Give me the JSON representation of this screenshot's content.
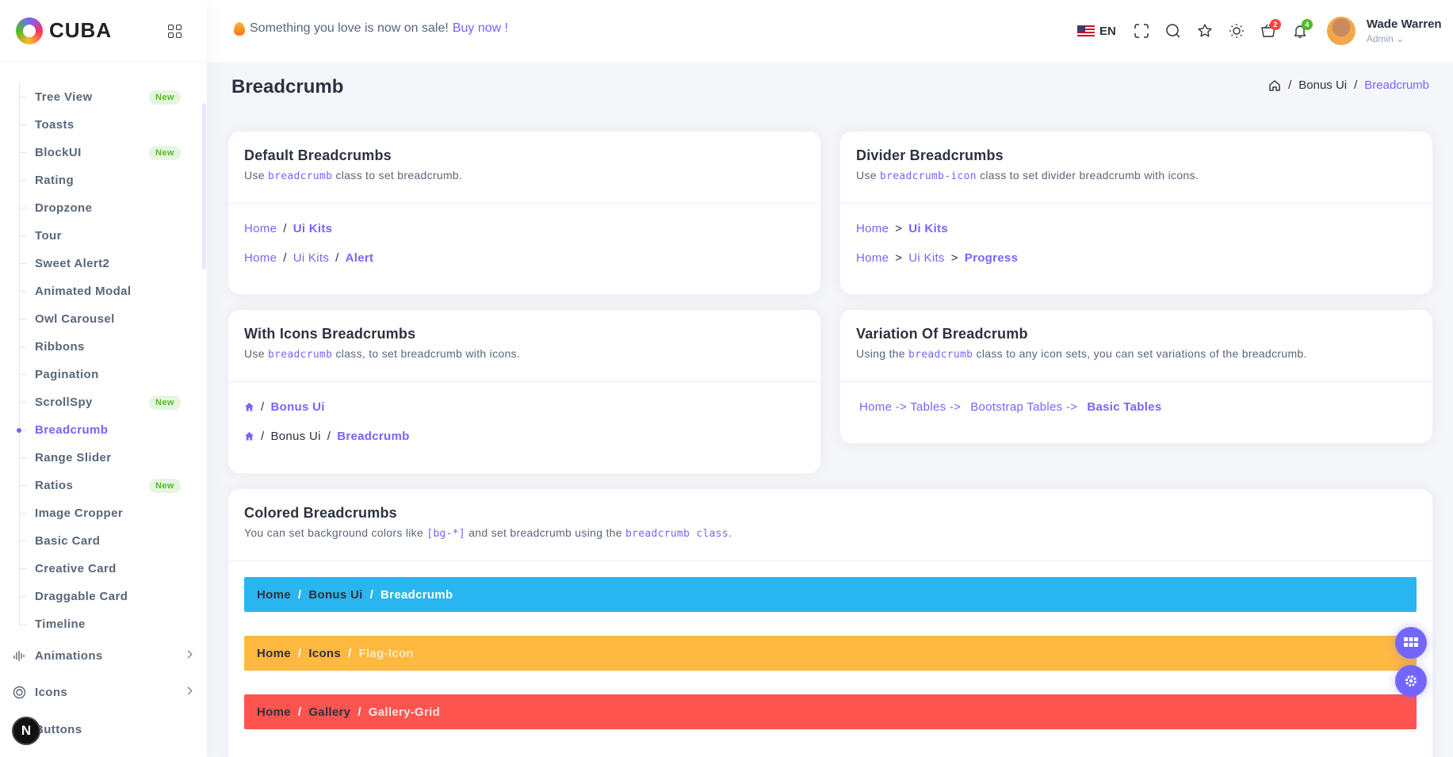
{
  "brand": {
    "name": "CUBA"
  },
  "sidebar": {
    "items": [
      {
        "label": "Tree View",
        "badge": "New"
      },
      {
        "label": "Toasts",
        "badge": ""
      },
      {
        "label": "BlockUI",
        "badge": "New"
      },
      {
        "label": "Rating",
        "badge": ""
      },
      {
        "label": "Dropzone",
        "badge": ""
      },
      {
        "label": "Tour",
        "badge": ""
      },
      {
        "label": "Sweet Alert2",
        "badge": ""
      },
      {
        "label": "Animated Modal",
        "badge": ""
      },
      {
        "label": "Owl Carousel",
        "badge": ""
      },
      {
        "label": "Ribbons",
        "badge": ""
      },
      {
        "label": "Pagination",
        "badge": ""
      },
      {
        "label": "ScrollSpy",
        "badge": "New"
      },
      {
        "label": "Breadcrumb",
        "badge": "",
        "active": true
      },
      {
        "label": "Range Slider",
        "badge": ""
      },
      {
        "label": "Ratios",
        "badge": "New"
      },
      {
        "label": "Image Cropper",
        "badge": ""
      },
      {
        "label": "Basic Card",
        "badge": ""
      },
      {
        "label": "Creative Card",
        "badge": ""
      },
      {
        "label": "Draggable Card",
        "badge": ""
      },
      {
        "label": "Timeline",
        "badge": ""
      }
    ],
    "groups": [
      {
        "label": "Animations",
        "icon": "animation-icon"
      },
      {
        "label": "Icons",
        "icon": "icons-icon"
      },
      {
        "label": "Buttons",
        "icon": "buttons-icon"
      }
    ],
    "next_badge": "N"
  },
  "header": {
    "promo_text": "Something you love is now on sale!",
    "promo_link": "Buy now !",
    "language": "EN",
    "cart_count": "2",
    "notif_count": "4",
    "user_name": "Wade Warren",
    "user_role": "Admin"
  },
  "page": {
    "title": "Breadcrumb",
    "crumb": [
      "Bonus Ui",
      "Breadcrumb"
    ]
  },
  "cards": {
    "default": {
      "title": "Default Breadcrumbs",
      "sub_pre": "Use ",
      "sub_code": "breadcrumb",
      "sub_post": " class to set breadcrumb.",
      "row1": [
        "Home",
        "Ui Kits"
      ],
      "row2": [
        "Home",
        "Ui Kits",
        "Alert"
      ]
    },
    "divider": {
      "title": "Divider Breadcrumbs",
      "sub_pre": "Use ",
      "sub_code": "breadcrumb-icon",
      "sub_post": " class to set divider breadcrumb with icons.",
      "row1": [
        "Home",
        "Ui Kits"
      ],
      "row2": [
        "Home",
        "Ui Kits",
        "Progress"
      ]
    },
    "icons": {
      "title": "With Icons Breadcrumbs",
      "sub_pre": "Use ",
      "sub_code": "breadcrumb",
      "sub_post": " class, to set breadcrumb with icons.",
      "row1": [
        "Bonus Ui"
      ],
      "row2": [
        "Bonus Ui",
        "Breadcrumb"
      ]
    },
    "variation": {
      "title": "Variation Of Breadcrumb",
      "sub_pre": "Using the ",
      "sub_code": "breadcrumb",
      "sub_post": " class to any icon sets, you can set variations of the breadcrumb.",
      "row": [
        "Home -> Tables ->",
        "Bootstrap Tables ->",
        "Basic Tables"
      ]
    },
    "colored": {
      "title": "Colored Breadcrumbs",
      "sub_pre": "You can set background colors like ",
      "sub_code1": "[bg-*]",
      "sub_mid": " and set breadcrumb using the ",
      "sub_code2": "breadcrumb class",
      "sub_post": ".",
      "bars": [
        {
          "items": [
            "Home",
            "Bonus Ui",
            "Breadcrumb"
          ],
          "color": "#29b6f0"
        },
        {
          "items": [
            "Home",
            "Icons",
            "Flag-Icon"
          ],
          "color": "#ffb840"
        },
        {
          "items": [
            "Home",
            "Gallery",
            "Gallery-Grid"
          ],
          "color": "#fd5450"
        }
      ]
    }
  },
  "colors": {
    "primary": "#7366ff",
    "success": "#51bb25",
    "danger": "#f73164"
  }
}
